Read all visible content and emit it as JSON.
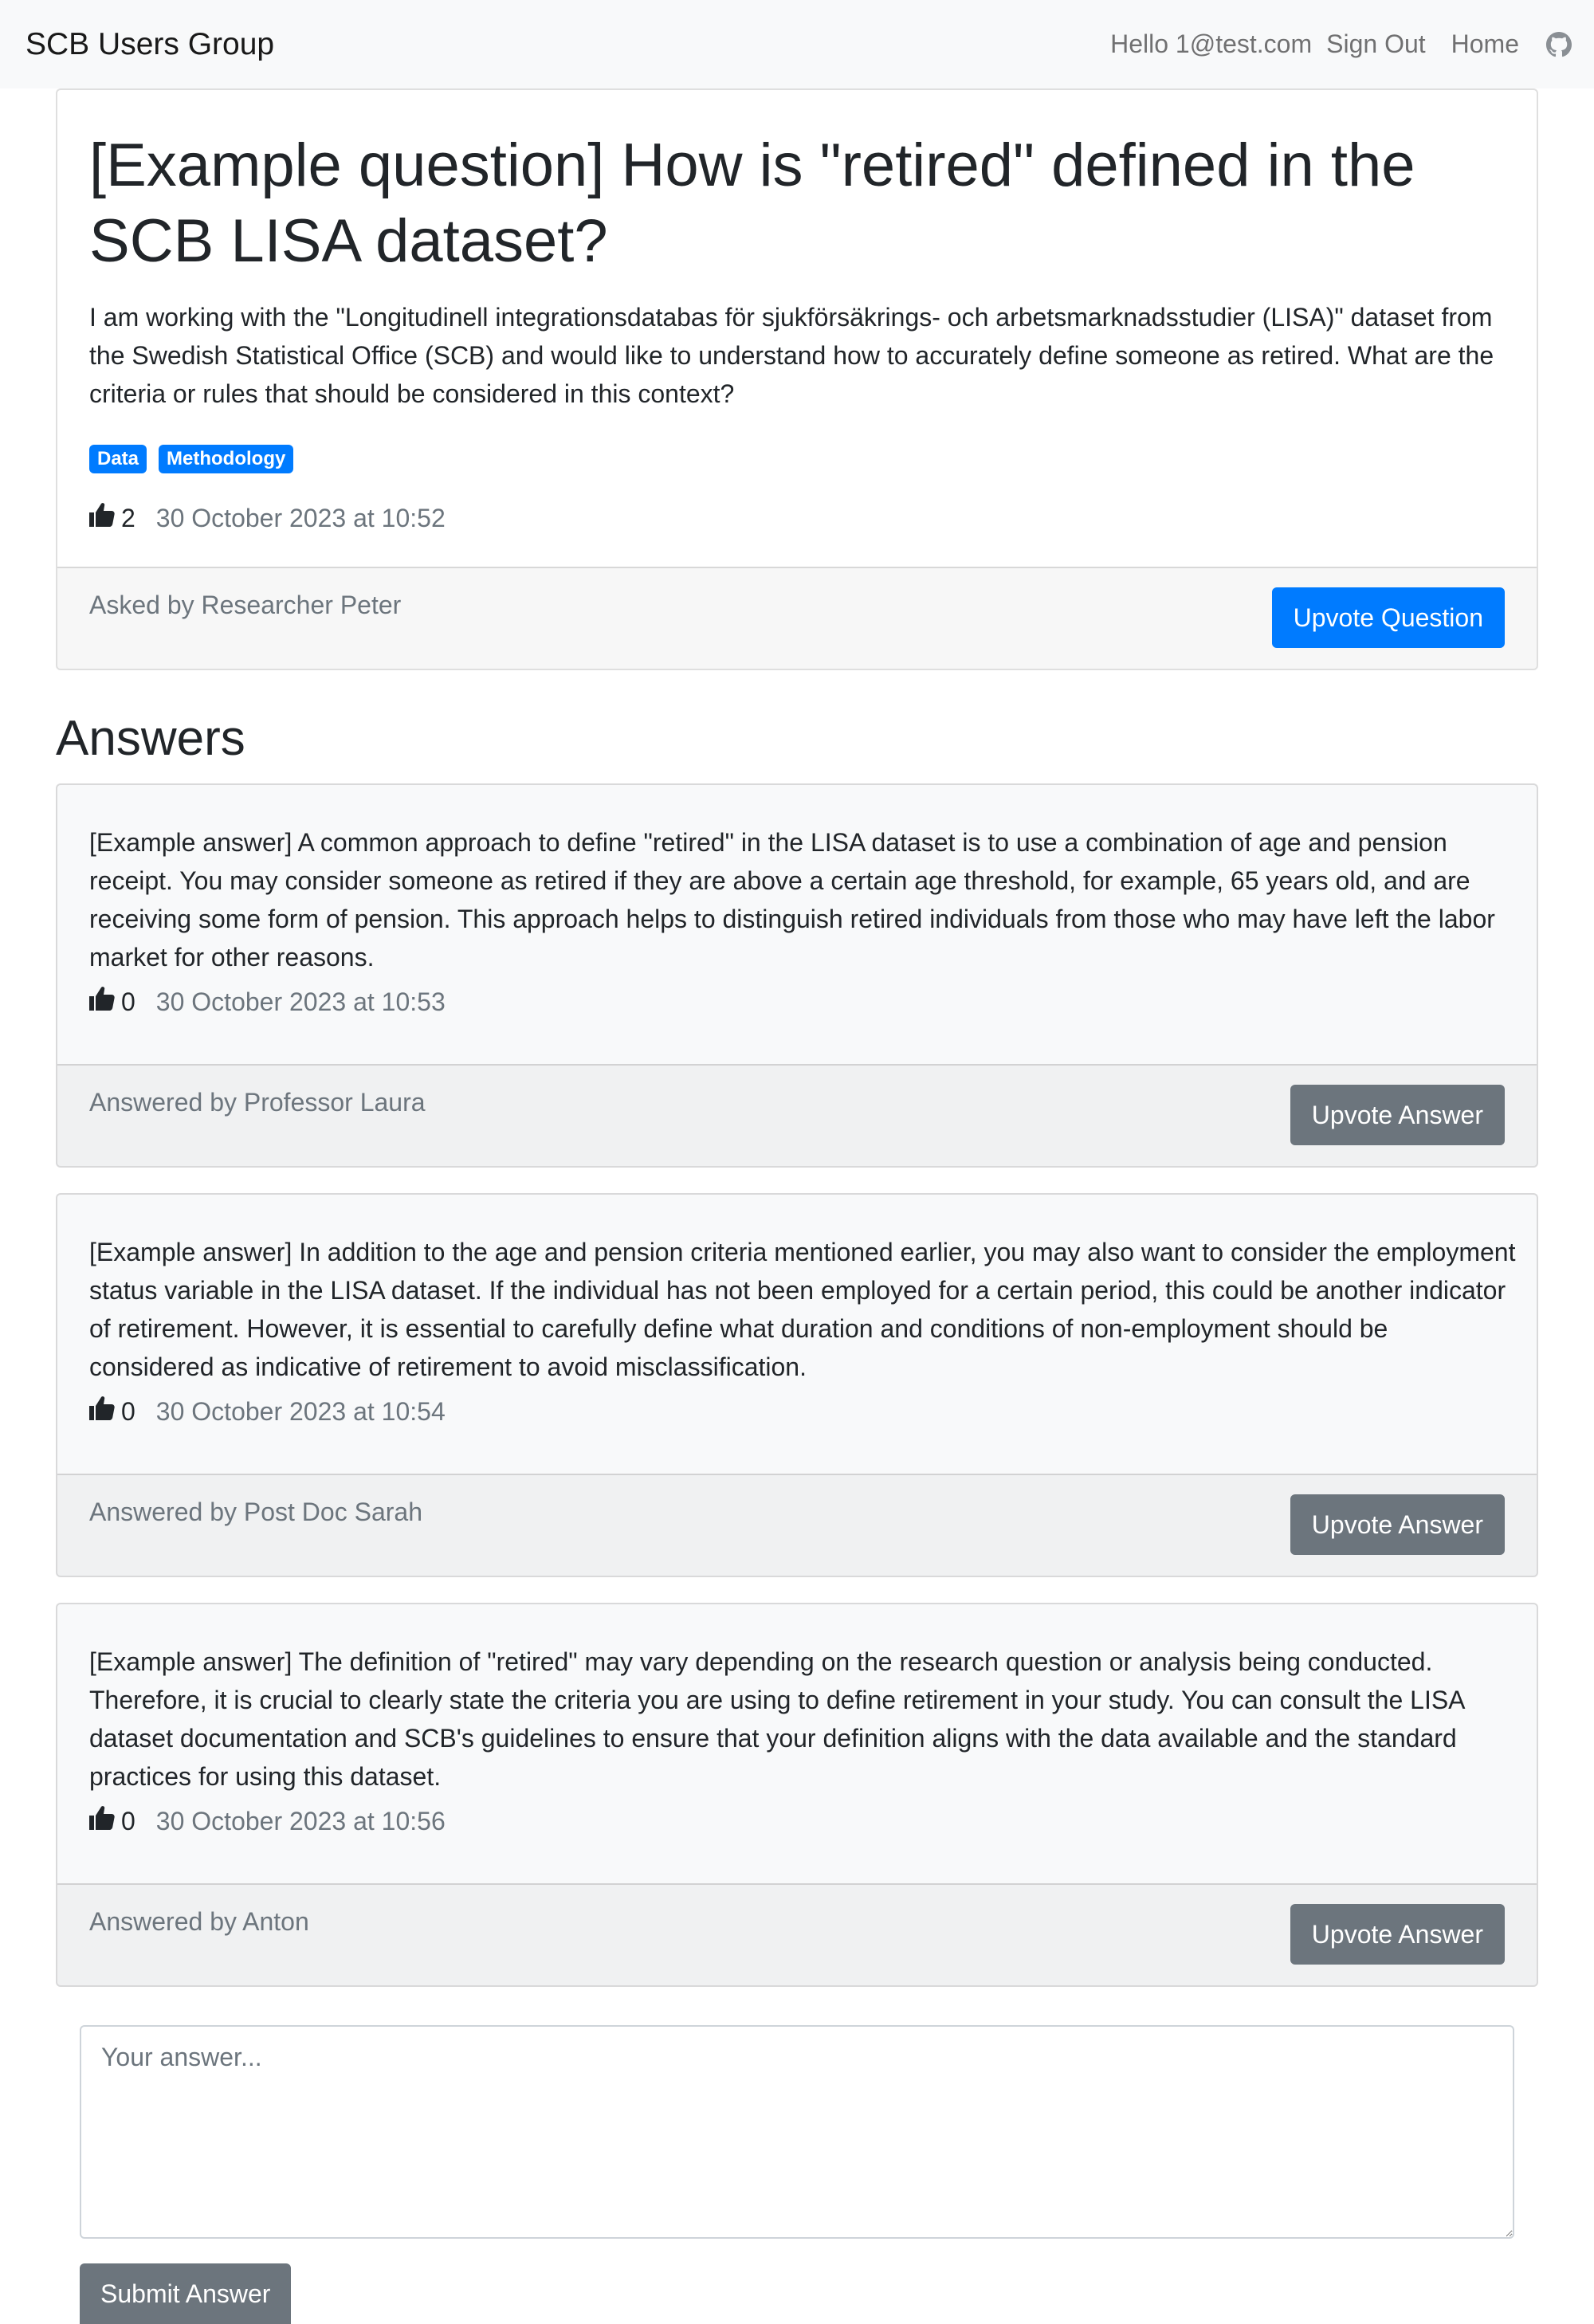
{
  "nav": {
    "brand": "SCB Users Group",
    "greeting": "Hello 1@test.com",
    "sign_out": "Sign Out",
    "home": "Home",
    "github_icon": "github-icon"
  },
  "question": {
    "title": "[Example question] How is \"retired\" defined in the SCB LISA dataset?",
    "body": "I am working with the \"Longitudinell integrationsdatabas för sjukförsäkrings- och arbetsmarknadsstudier (LISA)\" dataset from the Swedish Statistical Office (SCB) and would like to understand how to accurately define someone as retired. What are the criteria or rules that should be considered in this context?",
    "tags": [
      "Data",
      "Methodology"
    ],
    "votes": "2",
    "date": "30 October 2023 at 10:52",
    "asked_by": "Asked by Researcher Peter",
    "upvote_label": "Upvote Question"
  },
  "answers_heading": "Answers",
  "answers": [
    {
      "text": "[Example answer] A common approach to define \"retired\" in the LISA dataset is to use a combination of age and pension receipt. You may consider someone as retired if they are above a certain age threshold, for example, 65 years old, and are receiving some form of pension. This approach helps to distinguish retired individuals from those who may have left the labor market for other reasons.",
      "votes": "0",
      "date": "30 October 2023 at 10:53",
      "answered_by": "Answered by Professor Laura",
      "upvote_label": "Upvote Answer"
    },
    {
      "text": "[Example answer] In addition to the age and pension criteria mentioned earlier, you may also want to consider the employment status variable in the LISA dataset. If the individual has not been employed for a certain period, this could be another indicator of retirement. However, it is essential to carefully define what duration and conditions of non-employment should be considered as indicative of retirement to avoid misclassification.",
      "votes": "0",
      "date": "30 October 2023 at 10:54",
      "answered_by": "Answered by Post Doc Sarah",
      "upvote_label": "Upvote Answer"
    },
    {
      "text": "[Example answer] The definition of \"retired\" may vary depending on the research question or analysis being conducted. Therefore, it is crucial to clearly state the criteria you are using to define retirement in your study. You can consult the LISA dataset documentation and SCB's guidelines to ensure that your definition aligns with the data available and the standard practices for using this dataset.",
      "votes": "0",
      "date": "30 October 2023 at 10:56",
      "answered_by": "Answered by Anton",
      "upvote_label": "Upvote Answer"
    }
  ],
  "answer_form": {
    "placeholder": "Your answer...",
    "value": "",
    "submit_label": "Submit Answer"
  },
  "colors": {
    "primary": "#007bff",
    "secondary": "#6c757d",
    "navbar_bg": "#f8f9fa"
  }
}
